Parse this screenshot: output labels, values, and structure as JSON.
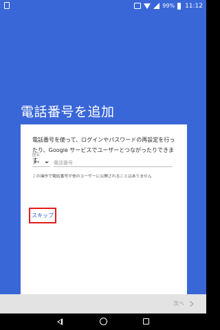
{
  "status_bar": {
    "battery_percent": "99%",
    "time": "11:12",
    "icons": [
      "sim-icon",
      "vibrate-icon",
      "wifi-icon",
      "signal-icon",
      "battery-icon"
    ]
  },
  "page": {
    "title": "電話番号を追加"
  },
  "card": {
    "description": "電話番号を使って、ログインやパスワードの再設定を行ったり、Google サービスでユーザーとつながったりできます。",
    "country_label": "国名",
    "country_code": "JP",
    "phone_placeholder": "電話番号",
    "phone_value": "",
    "notice": "この操作で電話番号が他のユーザーに公開されることはありません"
  },
  "actions": {
    "skip_label": "スキップ",
    "next_label": "次へ"
  },
  "colors": {
    "hero_blue": "#3a67d8",
    "link_blue": "#2e63d1",
    "highlight_red": "#e41b1b"
  }
}
